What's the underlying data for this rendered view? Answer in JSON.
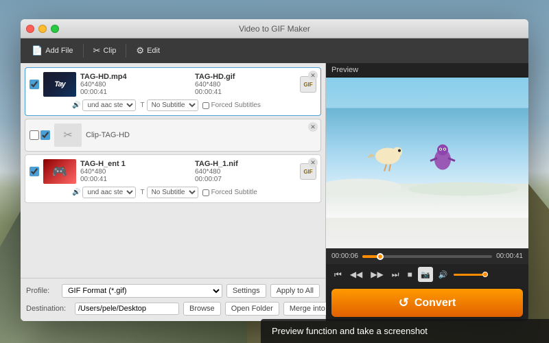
{
  "window": {
    "title": "Video to GIF Maker"
  },
  "toolbar": {
    "add_file": "Add File",
    "clip": "Clip",
    "edit": "Edit"
  },
  "preview": {
    "label": "Preview"
  },
  "files": [
    {
      "name_src": "TAG-HD.mp4",
      "name_dst": "TAG-HD.gif",
      "resolution": "640*480",
      "duration": "00:00:41",
      "duration_dst": "00:00:41",
      "audio": "und aac ste",
      "subtitle": "No Subtitle",
      "forced": "Forced Subtitles",
      "checked": true
    },
    {
      "name": "Clip-TAG-HD",
      "is_clip": true
    },
    {
      "name_src": "TAG-H_ent 1",
      "name_dst": "TAG-H_1.nif",
      "resolution": "640*480",
      "resolution_dst": "640*480",
      "duration": "00:00:41",
      "duration_dst": "00:00:07",
      "audio": "und aac ste",
      "subtitle": "No Subtitle",
      "forced": "Forced Subtitle",
      "checked": true
    }
  ],
  "profile": {
    "label": "Profile:",
    "value": "GIF Format (*.gif)",
    "settings": "Settings",
    "apply": "Apply to All"
  },
  "destination": {
    "label": "Destination:",
    "path": "/Users/pele/Desktop",
    "browse": "Browse",
    "open_folder": "Open Folder",
    "merge": "Merge into one file"
  },
  "player": {
    "time_current": "00:00:06",
    "time_total": "00:00:41",
    "progress_pct": 14,
    "controls": [
      "⏮",
      "◀◀",
      "▶▶",
      "⏭",
      "■"
    ],
    "volume_label": "volume"
  },
  "convert": {
    "label": "Convert",
    "icon": "↺"
  },
  "tooltip": {
    "text": "Preview function  and take a screenshot"
  }
}
